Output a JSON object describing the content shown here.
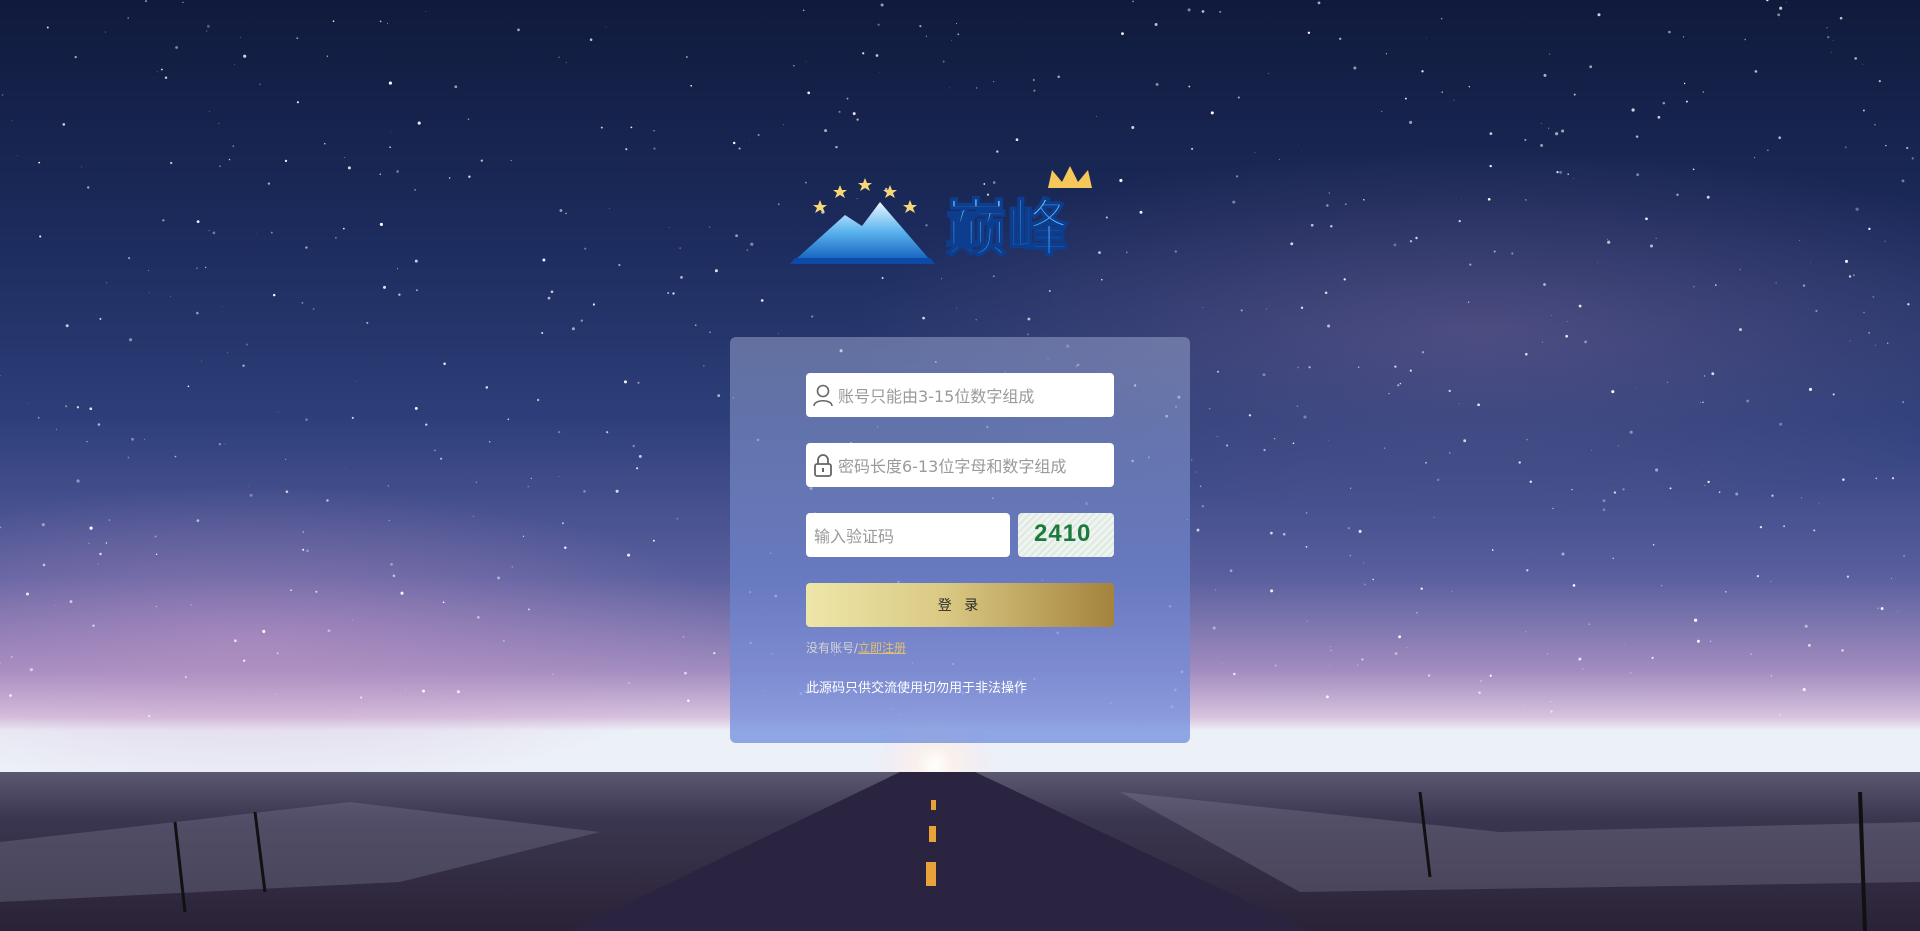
{
  "brand": {
    "logo_text": "巅峰"
  },
  "login": {
    "username_placeholder": "账号只能由3-15位数字组成",
    "password_placeholder": "密码长度6-13位字母和数字组成",
    "captcha_placeholder": "输入验证码",
    "captcha_code": "2410",
    "submit_label": "登 录",
    "register_prompt": "没有账号/",
    "register_link": "立即注册",
    "notice": "此源码只供交流使用切勿用于非法操作"
  },
  "colors": {
    "button_gradient_start": "#eee6a8",
    "button_gradient_end": "#a5833c",
    "link": "#e0c070",
    "captcha_text": "#1b7a3c"
  },
  "icons": {
    "username": "user-icon",
    "password": "lock-icon"
  }
}
